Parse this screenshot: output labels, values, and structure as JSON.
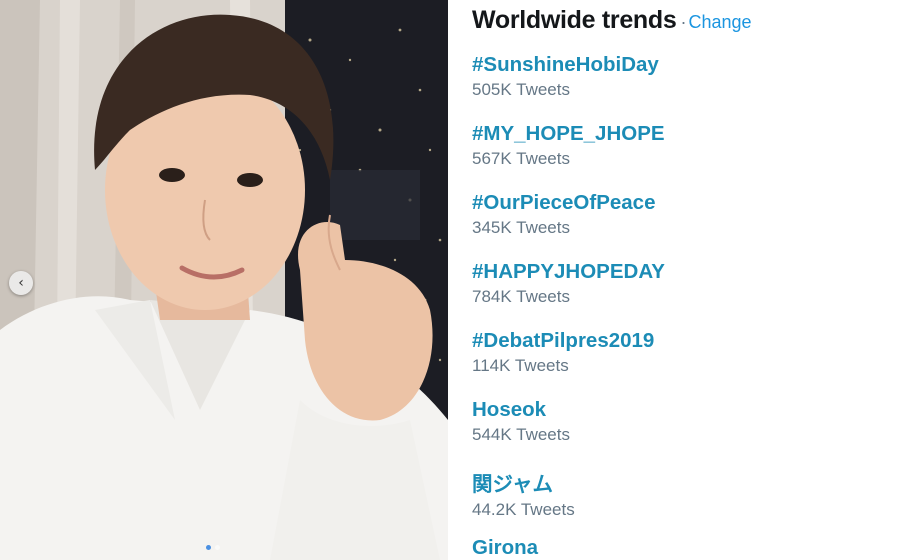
{
  "trends": {
    "title": "Worldwide trends",
    "separator": "·",
    "change_label": "Change",
    "items": [
      {
        "name": "#SunshineHobiDay",
        "count": "505K Tweets"
      },
      {
        "name": "#MY_HOPE_JHOPE",
        "count": "567K Tweets"
      },
      {
        "name": "#OurPieceOfPeace",
        "count": "345K Tweets"
      },
      {
        "name": "#HAPPYJHOPEDAY",
        "count": "784K Tweets"
      },
      {
        "name": "#DebatPilpres2019",
        "count": "114K Tweets"
      },
      {
        "name": "Hoseok",
        "count": "544K Tweets"
      },
      {
        "name": "関ジャム",
        "count": "44.2K Tweets"
      },
      {
        "name": "Girona",
        "count": ""
      }
    ]
  },
  "photo": {
    "carousel_arrow_icon": "chevron-left-icon",
    "arrow_glyph": "‹",
    "page_dots": 2,
    "active_dot": 1
  },
  "colors": {
    "trend_link": "#1c8cb6",
    "change_link": "#1b95e0",
    "count_text": "#657786",
    "title_text": "#14171a"
  }
}
